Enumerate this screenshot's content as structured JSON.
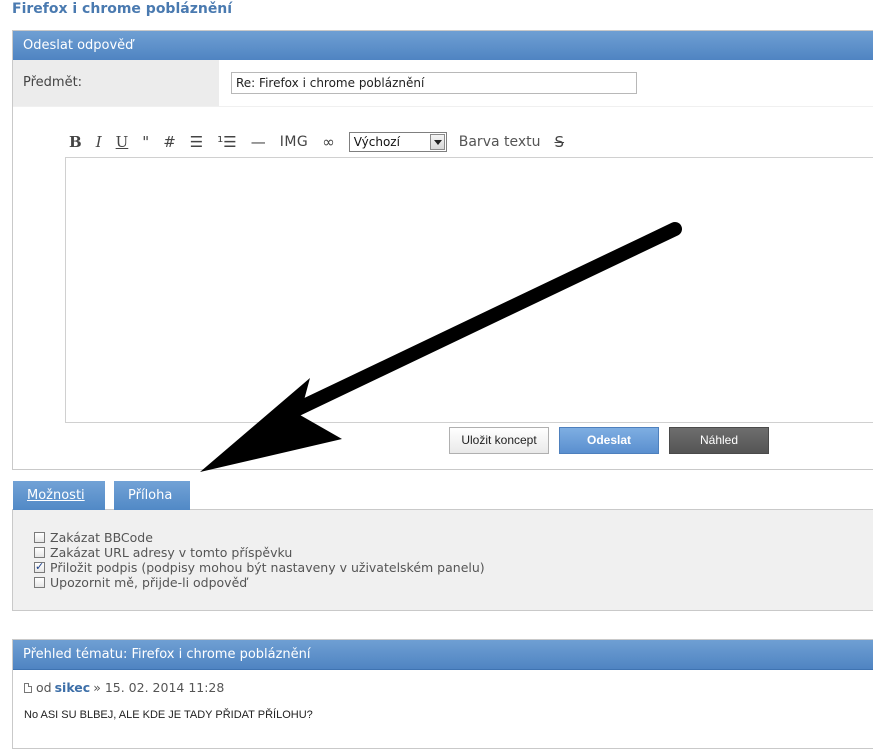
{
  "page_title": "Firefox i chrome pobláznění",
  "reply": {
    "header": "Odeslat odpověď",
    "subject_label": "Předmět:",
    "subject_value": "Re: Firefox i chrome pobláznění",
    "toolbar": {
      "bold": "B",
      "italic": "I",
      "underline": "U",
      "quote": "\"",
      "code": "#",
      "list": "☰",
      "numbered_list": "¹☰",
      "hr": "—",
      "img": "IMG",
      "link": "∞",
      "font_size_selected": "Výchozí",
      "color_label": "Barva textu",
      "strike": "S"
    },
    "buttons": {
      "draft": "Uložit koncept",
      "send": "Odeslat",
      "preview": "Náhled"
    }
  },
  "tabs": [
    {
      "label": "Možnosti"
    },
    {
      "label": "Příloha"
    }
  ],
  "options": [
    {
      "label": "Zakázat BBCode",
      "checked": false
    },
    {
      "label": "Zakázat URL adresy v tomto příspěvku",
      "checked": false
    },
    {
      "label": "Přiložit podpis (podpisy mohou být nastaveny v uživatelském panelu)",
      "checked": true
    },
    {
      "label": "Upozornit mě, přijde-li odpověď",
      "checked": false
    }
  ],
  "review": {
    "header": "Přehled tématu: Firefox i chrome pobláznění",
    "by": "od",
    "author": "sikec",
    "separator": "»",
    "date": "15. 02. 2014 11:28",
    "text": "No ASI SU BLBEJ, ALE KDE JE TADY PŘIDAT PŘÍLOHU?"
  },
  "colors": {
    "accent_blue": "#5a8fcf",
    "title_blue": "#4a7ab0",
    "arrow": "#000000"
  }
}
